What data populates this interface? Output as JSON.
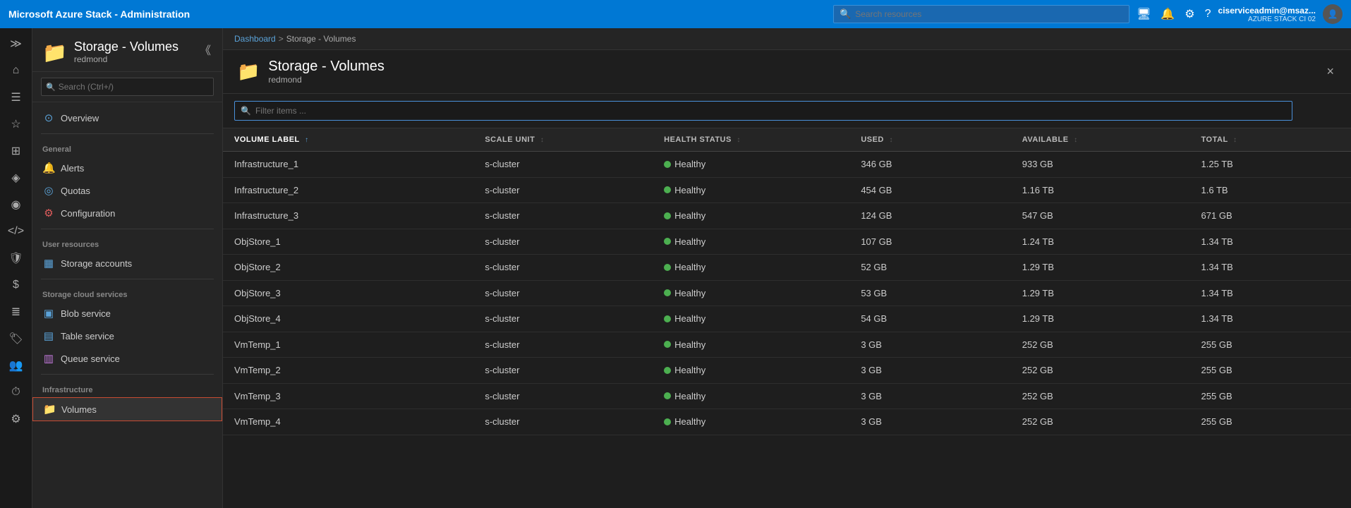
{
  "topbar": {
    "title": "Microsoft Azure Stack - Administration",
    "search_placeholder": "Search resources",
    "user": {
      "name": "ciserviceadmin@msaz...",
      "tenant": "AZURE STACK CI 02"
    }
  },
  "breadcrumb": {
    "home": "Dashboard",
    "separator": ">",
    "current": "Storage - Volumes"
  },
  "page": {
    "title": "Storage - Volumes",
    "subtitle": "redmond",
    "close_label": "×"
  },
  "filter": {
    "placeholder": "Filter items ..."
  },
  "table": {
    "columns": [
      {
        "id": "volume",
        "label": "VOLUME LABEL",
        "sort": "↑"
      },
      {
        "id": "scale",
        "label": "SCALE UNIT",
        "sort": "↕"
      },
      {
        "id": "health",
        "label": "HEALTH STATUS",
        "sort": "↕"
      },
      {
        "id": "used",
        "label": "USED",
        "sort": "↕"
      },
      {
        "id": "available",
        "label": "AVAILABLE",
        "sort": "↕"
      },
      {
        "id": "total",
        "label": "TOTAL",
        "sort": "↕"
      }
    ],
    "rows": [
      {
        "volume": "Infrastructure_1",
        "scale": "s-cluster",
        "health": "Healthy",
        "used": "346 GB",
        "available": "933 GB",
        "total": "1.25 TB"
      },
      {
        "volume": "Infrastructure_2",
        "scale": "s-cluster",
        "health": "Healthy",
        "used": "454 GB",
        "available": "1.16 TB",
        "total": "1.6 TB"
      },
      {
        "volume": "Infrastructure_3",
        "scale": "s-cluster",
        "health": "Healthy",
        "used": "124 GB",
        "available": "547 GB",
        "total": "671 GB"
      },
      {
        "volume": "ObjStore_1",
        "scale": "s-cluster",
        "health": "Healthy",
        "used": "107 GB",
        "available": "1.24 TB",
        "total": "1.34 TB"
      },
      {
        "volume": "ObjStore_2",
        "scale": "s-cluster",
        "health": "Healthy",
        "used": "52 GB",
        "available": "1.29 TB",
        "total": "1.34 TB"
      },
      {
        "volume": "ObjStore_3",
        "scale": "s-cluster",
        "health": "Healthy",
        "used": "53 GB",
        "available": "1.29 TB",
        "total": "1.34 TB"
      },
      {
        "volume": "ObjStore_4",
        "scale": "s-cluster",
        "health": "Healthy",
        "used": "54 GB",
        "available": "1.29 TB",
        "total": "1.34 TB"
      },
      {
        "volume": "VmTemp_1",
        "scale": "s-cluster",
        "health": "Healthy",
        "used": "3 GB",
        "available": "252 GB",
        "total": "255 GB"
      },
      {
        "volume": "VmTemp_2",
        "scale": "s-cluster",
        "health": "Healthy",
        "used": "3 GB",
        "available": "252 GB",
        "total": "255 GB"
      },
      {
        "volume": "VmTemp_3",
        "scale": "s-cluster",
        "health": "Healthy",
        "used": "3 GB",
        "available": "252 GB",
        "total": "255 GB"
      },
      {
        "volume": "VmTemp_4",
        "scale": "s-cluster",
        "health": "Healthy",
        "used": "3 GB",
        "available": "252 GB",
        "total": "255 GB"
      }
    ]
  },
  "sidebar": {
    "title": "Storage - Volumes",
    "subtitle": "redmond",
    "search_placeholder": "Search (Ctrl+/)",
    "nav": {
      "overview_label": "Overview",
      "general_section": "General",
      "alerts_label": "Alerts",
      "quotas_label": "Quotas",
      "configuration_label": "Configuration",
      "user_resources_section": "User resources",
      "storage_accounts_label": "Storage accounts",
      "storage_cloud_section": "Storage cloud services",
      "blob_service_label": "Blob service",
      "table_service_label": "Table service",
      "queue_service_label": "Queue service",
      "infrastructure_section": "Infrastructure",
      "volumes_label": "Volumes"
    }
  },
  "rail": {
    "icons": [
      "≡",
      "⌂",
      "☆",
      "⊞",
      "♦",
      "◎",
      "≈",
      "●",
      "⏱",
      "≣"
    ]
  }
}
